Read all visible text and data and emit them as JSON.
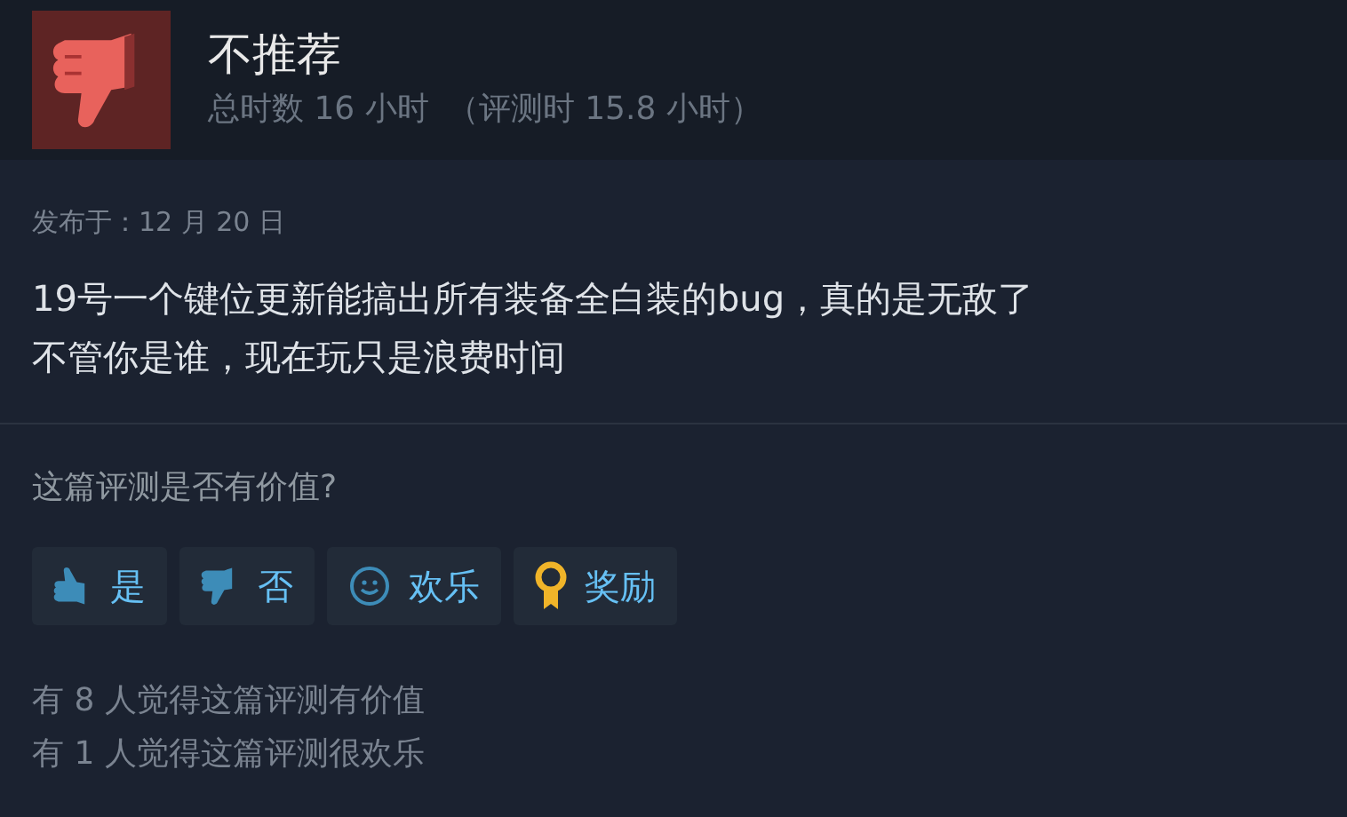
{
  "review": {
    "verdict": "不推荐",
    "kind": "negative",
    "playtime": "总时数 16 小时",
    "playtime_at_review": "（评测时 15.8 小时）"
  },
  "posted": "发布于：12 月 20 日",
  "body": [
    "19号一个键位更新能搞出所有装备全白装的bug，真的是无敌了",
    "不管你是谁，现在玩只是浪费时间"
  ],
  "question": "这篇评测是否有价值?",
  "buttons": [
    {
      "kind": "yes",
      "label": "是"
    },
    {
      "kind": "no",
      "label": "否"
    },
    {
      "kind": "funny",
      "label": "欢乐"
    },
    {
      "kind": "award",
      "label": "奖励"
    }
  ],
  "stats": [
    "有 8 人觉得这篇评测有价值",
    "有 1 人觉得这篇评测很欢乐"
  ]
}
